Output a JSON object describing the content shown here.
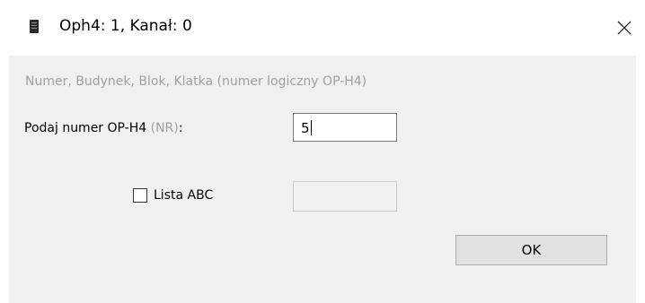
{
  "window": {
    "title": "Oph4: 1, Kanał: 0",
    "icon": "document-icon"
  },
  "controls": {
    "close_glyph": "close-icon"
  },
  "form": {
    "hint": "Numer, Budynek, Blok, Klatka (numer logiczny OP-H4)",
    "nr_label_main": "Podaj numer OP-H4",
    "nr_label_muted": "(NR)",
    "nr_label_colon": ":",
    "nr_value": "5",
    "abc_checked": false,
    "abc_label": "Lista ABC",
    "abc_value": "",
    "ok_label": "OK"
  },
  "colors": {
    "dialog_bg": "#f0f0f0",
    "muted_text": "#a0a0a0",
    "button_bg": "#e1e1e1"
  }
}
